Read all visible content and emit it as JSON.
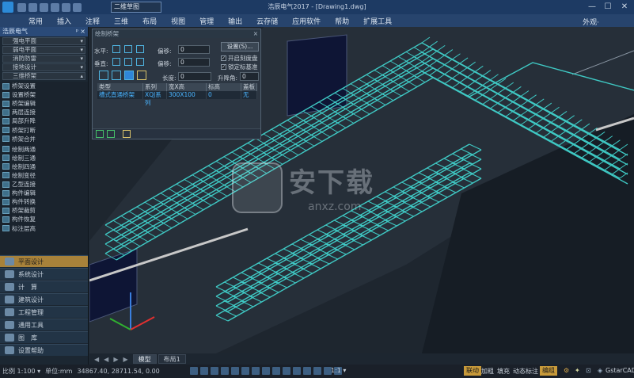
{
  "titlebar": {
    "view_select": "二维草图",
    "doc_title": "浩辰电气2017 - [Drawing1.dwg]",
    "minimize": "—",
    "maximize": "☐",
    "close": "✕"
  },
  "menubar": {
    "items": [
      "常用",
      "插入",
      "注释",
      "三维",
      "布局",
      "视图",
      "管理",
      "输出",
      "云存储",
      "应用软件",
      "帮助",
      "扩展工具"
    ],
    "appearance": "外观·"
  },
  "leftpanel": {
    "title": "浩辰电气",
    "pin": "ᵖ",
    "close": "×",
    "dropdowns": [
      "强电平面",
      "弱电平面",
      "消防防雷",
      "接地设计",
      "三维桥架"
    ],
    "items": [
      "桥架设置",
      "设置桥架",
      "桥架编辑",
      "两层连接",
      "局部升降",
      "桥架打断",
      "桥架合并",
      "绘制两通",
      "绘制三通",
      "绘制四通",
      "绘制变径",
      "乙型连接",
      "构件编辑",
      "构件转换",
      "桥架裁剪",
      "构件恢复",
      "标注层高"
    ],
    "sections": [
      "平面设计",
      "系统设计",
      "计　算",
      "建筑设计",
      "工程管理",
      "通用工具",
      "图　库",
      "设置帮助"
    ]
  },
  "dialog": {
    "title": "绘制桥架",
    "close": "×",
    "horizontal_label": "水平:",
    "vertical_label": "垂直:",
    "offset1_label": "偏移:",
    "offset1_value": "0",
    "offset2_label": "偏移:",
    "offset2_value": "0",
    "settings_button": "设置(S)...",
    "chk_open_scale": "开启刻度盘",
    "chk_lock_base": "锁定标基准",
    "length_label": "长度:",
    "length_value": "0",
    "lift_label": "升降角:",
    "lift_value": "0",
    "table": {
      "headers": [
        "类型",
        "系列",
        "宽X高",
        "标高",
        "盖板"
      ],
      "rows": [
        [
          "槽式直通桥架",
          "XQJ系列",
          "300X100",
          "0",
          "无"
        ]
      ]
    }
  },
  "tabs": {
    "nav": [
      "◀",
      "◀",
      "▶",
      "▶"
    ],
    "items": [
      "模型",
      "布局1"
    ]
  },
  "statusbar": {
    "scale": "比例 1:100 ▾",
    "unit": "单位:mm",
    "coords": "34867.40, 28711.54, 0.00",
    "zoom": "1:1 ▾",
    "badge_linked": "联动",
    "thicken": "加粗",
    "fill": "填充",
    "dyn_label": "动态标注",
    "badge_edit": "编组",
    "brand": "GstarCAD"
  },
  "watermark": {
    "cn": "安下载",
    "en": "anxz.com"
  },
  "colors": {
    "title_bg": "#1d3a63",
    "menu_bg": "#27446d",
    "cable_tray": "#3fc9c4",
    "active_section": "#a8823a"
  }
}
